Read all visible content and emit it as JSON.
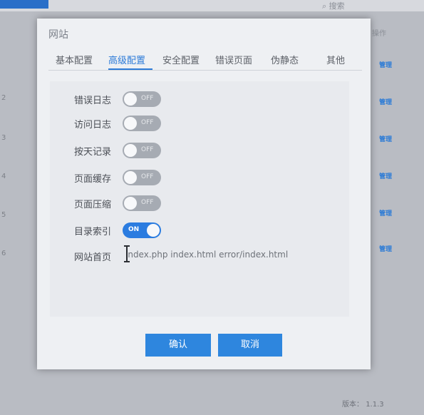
{
  "background": {
    "search_placeholder": "搜索",
    "column_header": "操作",
    "row_indices": [
      "2",
      "3",
      "4",
      "5",
      "6"
    ],
    "row_action": "管理",
    "version_label": "版本：",
    "version_value": "1.1.3"
  },
  "dialog": {
    "title": "网站",
    "tabs": [
      {
        "label": "基本配置",
        "active": false
      },
      {
        "label": "高级配置",
        "active": true
      },
      {
        "label": "安全配置",
        "active": false
      },
      {
        "label": "错误页面",
        "active": false
      },
      {
        "label": "伪静态",
        "active": false
      },
      {
        "label": "其他",
        "active": false
      }
    ],
    "fields": [
      {
        "label": "错误日志",
        "toggle": "OFF",
        "on": false
      },
      {
        "label": "访问日志",
        "toggle": "OFF",
        "on": false
      },
      {
        "label": "按天记录",
        "toggle": "OFF",
        "on": false
      },
      {
        "label": "页面缓存",
        "toggle": "OFF",
        "on": false
      },
      {
        "label": "页面压缩",
        "toggle": "OFF",
        "on": false
      },
      {
        "label": "目录索引",
        "toggle": "ON",
        "on": true
      }
    ],
    "homepage": {
      "label": "网站首页",
      "value": "index.php index.html error/index.html"
    },
    "confirm_label": "确认",
    "cancel_label": "取消"
  },
  "colors": {
    "accent": "#2e86de",
    "toggle_off": "#a6abb3",
    "dialog_bg": "#eef0f3"
  }
}
